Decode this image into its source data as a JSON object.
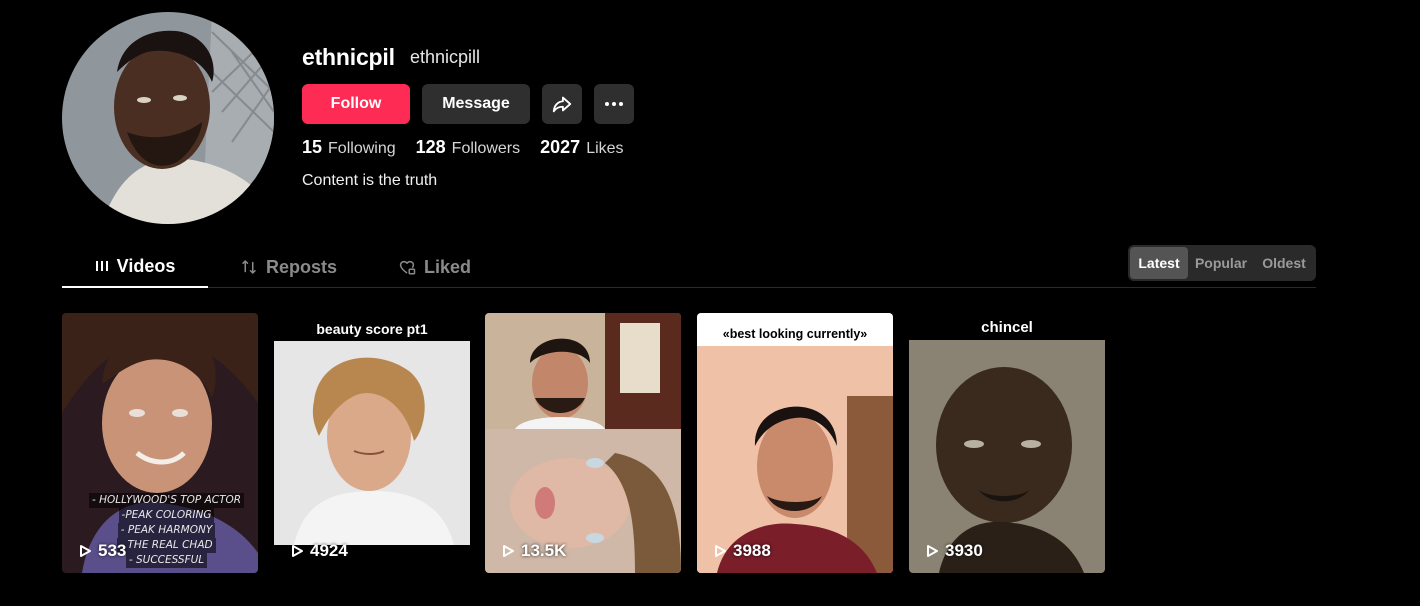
{
  "profile": {
    "unique_id": "ethnicpil",
    "nickname": "ethnicpill",
    "bio": "Content is the truth"
  },
  "actions": {
    "follow_label": "Follow",
    "message_label": "Message",
    "share_icon": "share-icon",
    "more_icon": "more-icon"
  },
  "stats": [
    {
      "value": "15",
      "label": "Following"
    },
    {
      "value": "128",
      "label": "Followers"
    },
    {
      "value": "2027",
      "label": "Likes"
    }
  ],
  "tabs": [
    {
      "label": "Videos",
      "icon": "grid-icon",
      "active": true
    },
    {
      "label": "Reposts",
      "icon": "repost-icon",
      "active": false
    },
    {
      "label": "Liked",
      "icon": "heart-lock-icon",
      "active": false
    }
  ],
  "sort": {
    "options": [
      "Latest",
      "Popular",
      "Oldest"
    ],
    "selected": "Latest"
  },
  "videos": [
    {
      "views": "533",
      "caption": "",
      "overlay_text": [
        "- HOLLYWOOD'S TOP ACTOR",
        "-PEAK COLORING",
        "- PEAK HARMONY",
        "- THE REAL CHAD",
        "- SUCCESSFUL"
      ]
    },
    {
      "views": "4924",
      "caption": "beauty score pt1"
    },
    {
      "views": "13.5K",
      "caption": ""
    },
    {
      "views": "3988",
      "caption": "«best looking currently»"
    },
    {
      "views": "3930",
      "caption": "chincel"
    }
  ],
  "colors": {
    "accent": "#fe2c55",
    "background": "#000000",
    "button_bg": "#2f2f2f"
  }
}
